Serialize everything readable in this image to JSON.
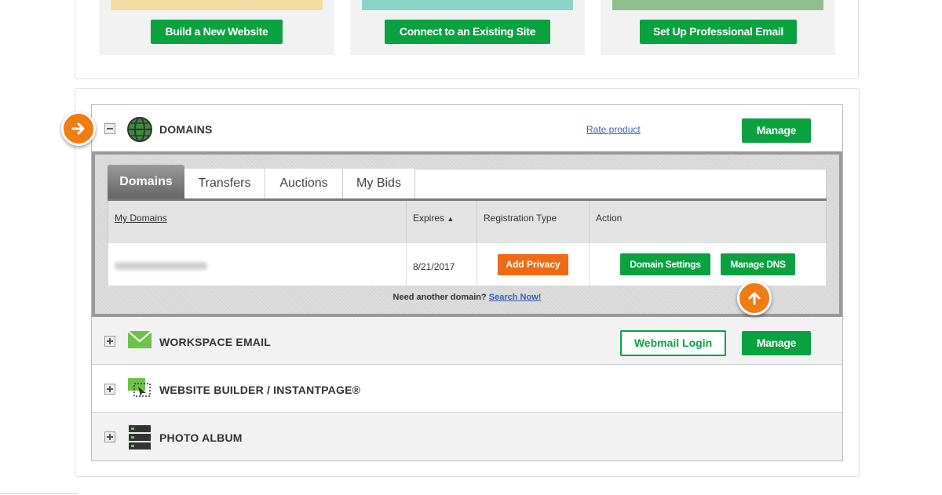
{
  "promos": [
    {
      "button_label": "Build a New Website"
    },
    {
      "button_label": "Connect to an Existing Site"
    },
    {
      "button_label": "Set Up Professional Email"
    }
  ],
  "domains_row": {
    "title": "DOMAINS",
    "rate_link": "Rate product",
    "manage_label": "Manage"
  },
  "tabs": [
    "Domains",
    "Transfers",
    "Auctions",
    "My Bids"
  ],
  "table": {
    "headers": {
      "my_domains": "My Domains",
      "expires": "Expires",
      "registration_type": "Registration Type",
      "action": "Action"
    },
    "row": {
      "expires": "8/21/2017",
      "privacy_button": "Add Privacy",
      "settings_button": "Domain Settings",
      "dns_button": "Manage DNS"
    }
  },
  "footer": {
    "text": "Need another domain?",
    "link": "Search Now!"
  },
  "workspace_row": {
    "title": "WORKSPACE EMAIL",
    "webmail_label": "Webmail Login",
    "manage_label": "Manage"
  },
  "builder_row": {
    "title": "WEBSITE BUILDER / INSTANTPAGE®"
  },
  "photo_row": {
    "title": "PHOTO ALBUM"
  },
  "colors": {
    "green": "#0aa140",
    "orange": "#f07c14",
    "link": "#3b5fb5"
  },
  "icons": [
    "globe-icon",
    "envelope-icon",
    "website-builder-icon",
    "server-icon",
    "arrow-right-icon",
    "arrow-up-icon",
    "sort-up-icon"
  ]
}
